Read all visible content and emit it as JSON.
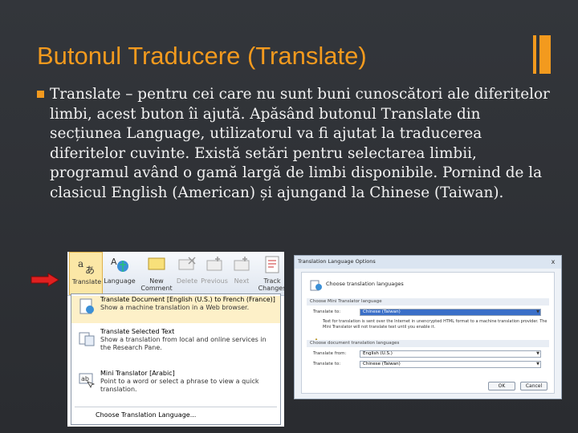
{
  "slide": {
    "title": "Butonul Traducere (Translate)",
    "bullet": "Translate – pentru cei care nu sunt buni cunoscători ale diferitelor limbi, acest buton îi ajută. Apăsând butonul Translate din secțiunea Language, utilizatorul va fi ajutat la traducerea diferitelor cuvinte. Există setări pentru selectarea limbii, programul având o gamă largă de limbi disponibile. Pornind de la clasicul English (American) și ajungand la Chinese (Taiwan).",
    "accent_color": "#f39a1e"
  },
  "ribbon": {
    "buttons": [
      {
        "label": "Translate",
        "icon": "translate-icon"
      },
      {
        "label": "Language",
        "icon": "language-icon"
      },
      {
        "label": "New Comment",
        "icon": "new-comment-icon"
      },
      {
        "label": "Delete",
        "icon": "delete-comment-icon"
      },
      {
        "label": "Previous",
        "icon": "previous-comment-icon"
      },
      {
        "label": "Next",
        "icon": "next-comment-icon"
      },
      {
        "label": "Track Changes",
        "icon": "track-changes-icon"
      }
    ]
  },
  "translate_menu": {
    "items": [
      {
        "title": "Translate Document [English (U.S.) to French (France)]",
        "desc": "Show a machine translation in a Web browser."
      },
      {
        "title": "Translate Selected Text",
        "desc": "Show a translation from local and online services in the Research Pane."
      },
      {
        "title": "Mini Translator [Arabic]",
        "desc": "Point to a word or select a phrase to view a quick translation."
      }
    ],
    "footer": "Choose Translation Language..."
  },
  "dialog": {
    "title": "Translation Language Options",
    "close": "x",
    "heading": "Choose translation languages",
    "mini_section": "Choose Mini Translator language",
    "mini_label": "Translate to:",
    "mini_value": "Chinese (Taiwan)",
    "warning": "Text for translation is sent over the Internet in unencrypted HTML format to a machine translation provider. The Mini Translator will not translate text until you enable it.",
    "doc_section": "Choose document translation languages",
    "from_label": "Translate from:",
    "from_value": "English (U.S.)",
    "to_label": "Translate to:",
    "to_value": "Chinese (Taiwan)",
    "ok": "OK",
    "cancel": "Cancel"
  }
}
